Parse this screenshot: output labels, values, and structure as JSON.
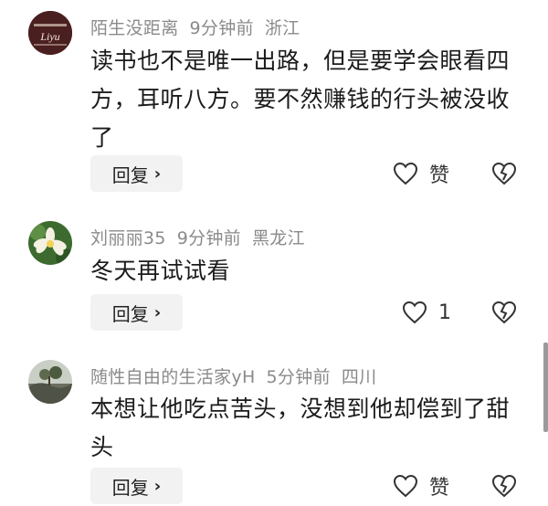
{
  "comments": [
    {
      "username": "陌生没距离",
      "time": "9分钟前",
      "location": "浙江",
      "text": "读书也不是唯一出路，但是要学会眼看四方，耳听八方。要不然赚钱的行头被没收了",
      "reply_label": "回复",
      "like_label": "赞",
      "avatar_text": "Liyu"
    },
    {
      "username": "刘丽丽35",
      "time": "9分钟前",
      "location": "黑龙江",
      "text": "冬天再试试看",
      "reply_label": "回复",
      "like_label": "1"
    },
    {
      "username": "随性自由的生活家yH",
      "time": "5分钟前",
      "location": "四川",
      "text": "本想让他吃点苦头，没想到他却偿到了甜头",
      "reply_label": "回复",
      "like_label": "赞"
    }
  ],
  "icons": {
    "like": "heart-outline-icon",
    "dislike": "broken-heart-icon",
    "reply_chevron": "chevron-right-icon"
  },
  "colors": {
    "meta_text": "#8a8a8a",
    "reply_bg": "#f2f2f2"
  }
}
